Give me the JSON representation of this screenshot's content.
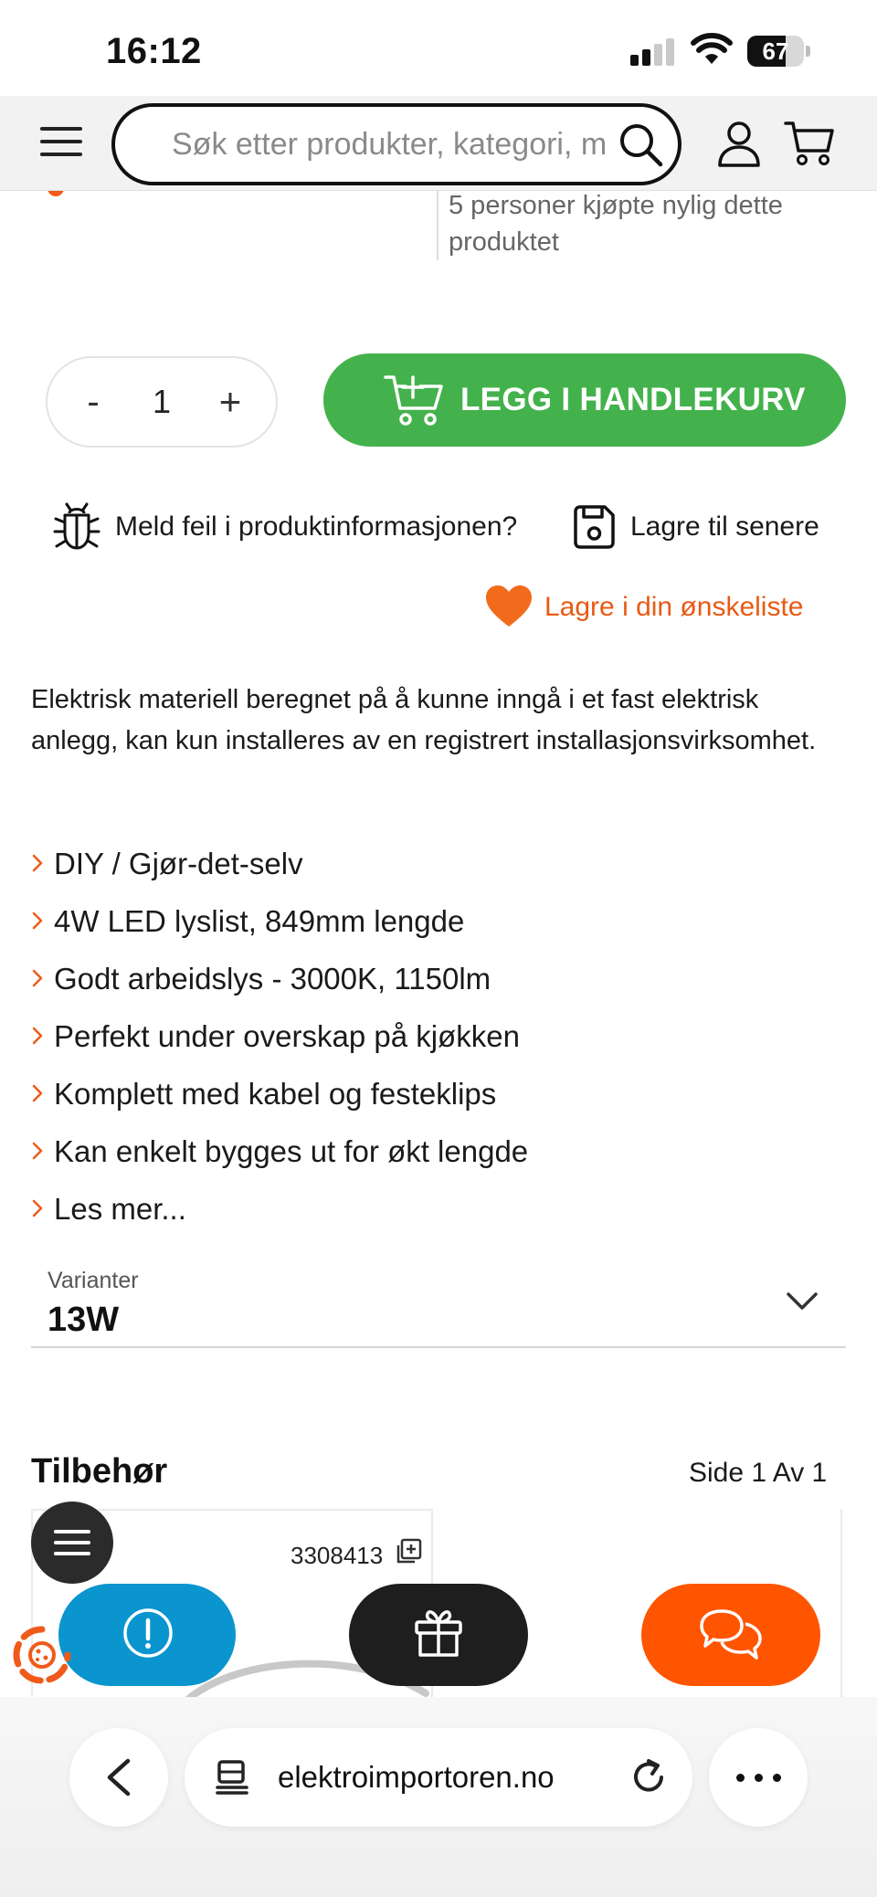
{
  "status_bar": {
    "time": "16:12",
    "battery": "67",
    "battery_level": 0.67
  },
  "header": {
    "search_placeholder": "Søk etter produkter, kategori, m",
    "icons": [
      "menu-icon",
      "search-icon",
      "user-icon",
      "cart-icon"
    ]
  },
  "info_row": {
    "purchase_text": "5 personer kjøpte nylig dette produktet"
  },
  "purchase": {
    "quantity": "1",
    "minus_label": "-",
    "plus_label": "+",
    "add_to_cart_label": "LEGG I HANDLEKURV",
    "button_color": "#44b24c"
  },
  "actions": {
    "report_label": "Meld feil i produktinformasjonen?",
    "save_later_label": "Lagre til senere",
    "wishlist_label": "Lagre i din ønskeliste",
    "accent_color": "#e85b14"
  },
  "description": "Elektrisk materiell beregnet på å kunne inngå i et fast elektrisk anlegg, kan kun installeres av en registrert installasjonsvirksomhet.",
  "features": [
    "DIY / Gjør-det-selv",
    "4W LED lyslist, 849mm lengde",
    "Godt arbeidslys - 3000K, 1150lm",
    "Perfekt under overskap på kjøkken",
    "Komplett med kabel og festeklips",
    "Kan enkelt bygges ut for økt lengde",
    "Les mer..."
  ],
  "variants": {
    "label": "Varianter",
    "selected": "13W"
  },
  "accessories": {
    "title": "Tilbehør",
    "page_text": "Side 1 Av  1",
    "card_sku": "3308413"
  },
  "floating_buttons": {
    "info_color": "#0b95cf",
    "gift_color": "#1e1e1e",
    "chat_color": "#ff5500"
  },
  "browser": {
    "url": "elektroimportoren.no"
  }
}
